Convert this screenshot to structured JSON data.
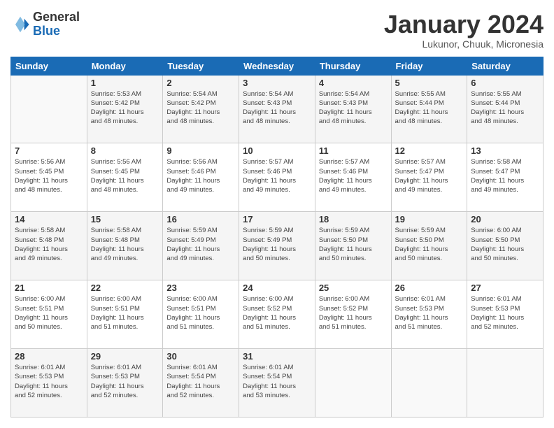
{
  "header": {
    "logo_line1": "General",
    "logo_line2": "Blue",
    "month_title": "January 2024",
    "location": "Lukunor, Chuuk, Micronesia"
  },
  "days_of_week": [
    "Sunday",
    "Monday",
    "Tuesday",
    "Wednesday",
    "Thursday",
    "Friday",
    "Saturday"
  ],
  "weeks": [
    [
      {
        "day": "",
        "info": ""
      },
      {
        "day": "1",
        "info": "Sunrise: 5:53 AM\nSunset: 5:42 PM\nDaylight: 11 hours\nand 48 minutes."
      },
      {
        "day": "2",
        "info": "Sunrise: 5:54 AM\nSunset: 5:42 PM\nDaylight: 11 hours\nand 48 minutes."
      },
      {
        "day": "3",
        "info": "Sunrise: 5:54 AM\nSunset: 5:43 PM\nDaylight: 11 hours\nand 48 minutes."
      },
      {
        "day": "4",
        "info": "Sunrise: 5:54 AM\nSunset: 5:43 PM\nDaylight: 11 hours\nand 48 minutes."
      },
      {
        "day": "5",
        "info": "Sunrise: 5:55 AM\nSunset: 5:44 PM\nDaylight: 11 hours\nand 48 minutes."
      },
      {
        "day": "6",
        "info": "Sunrise: 5:55 AM\nSunset: 5:44 PM\nDaylight: 11 hours\nand 48 minutes."
      }
    ],
    [
      {
        "day": "7",
        "info": "Sunrise: 5:56 AM\nSunset: 5:45 PM\nDaylight: 11 hours\nand 48 minutes."
      },
      {
        "day": "8",
        "info": "Sunrise: 5:56 AM\nSunset: 5:45 PM\nDaylight: 11 hours\nand 48 minutes."
      },
      {
        "day": "9",
        "info": "Sunrise: 5:56 AM\nSunset: 5:46 PM\nDaylight: 11 hours\nand 49 minutes."
      },
      {
        "day": "10",
        "info": "Sunrise: 5:57 AM\nSunset: 5:46 PM\nDaylight: 11 hours\nand 49 minutes."
      },
      {
        "day": "11",
        "info": "Sunrise: 5:57 AM\nSunset: 5:46 PM\nDaylight: 11 hours\nand 49 minutes."
      },
      {
        "day": "12",
        "info": "Sunrise: 5:57 AM\nSunset: 5:47 PM\nDaylight: 11 hours\nand 49 minutes."
      },
      {
        "day": "13",
        "info": "Sunrise: 5:58 AM\nSunset: 5:47 PM\nDaylight: 11 hours\nand 49 minutes."
      }
    ],
    [
      {
        "day": "14",
        "info": "Sunrise: 5:58 AM\nSunset: 5:48 PM\nDaylight: 11 hours\nand 49 minutes."
      },
      {
        "day": "15",
        "info": "Sunrise: 5:58 AM\nSunset: 5:48 PM\nDaylight: 11 hours\nand 49 minutes."
      },
      {
        "day": "16",
        "info": "Sunrise: 5:59 AM\nSunset: 5:49 PM\nDaylight: 11 hours\nand 49 minutes."
      },
      {
        "day": "17",
        "info": "Sunrise: 5:59 AM\nSunset: 5:49 PM\nDaylight: 11 hours\nand 50 minutes."
      },
      {
        "day": "18",
        "info": "Sunrise: 5:59 AM\nSunset: 5:50 PM\nDaylight: 11 hours\nand 50 minutes."
      },
      {
        "day": "19",
        "info": "Sunrise: 5:59 AM\nSunset: 5:50 PM\nDaylight: 11 hours\nand 50 minutes."
      },
      {
        "day": "20",
        "info": "Sunrise: 6:00 AM\nSunset: 5:50 PM\nDaylight: 11 hours\nand 50 minutes."
      }
    ],
    [
      {
        "day": "21",
        "info": "Sunrise: 6:00 AM\nSunset: 5:51 PM\nDaylight: 11 hours\nand 50 minutes."
      },
      {
        "day": "22",
        "info": "Sunrise: 6:00 AM\nSunset: 5:51 PM\nDaylight: 11 hours\nand 51 minutes."
      },
      {
        "day": "23",
        "info": "Sunrise: 6:00 AM\nSunset: 5:51 PM\nDaylight: 11 hours\nand 51 minutes."
      },
      {
        "day": "24",
        "info": "Sunrise: 6:00 AM\nSunset: 5:52 PM\nDaylight: 11 hours\nand 51 minutes."
      },
      {
        "day": "25",
        "info": "Sunrise: 6:00 AM\nSunset: 5:52 PM\nDaylight: 11 hours\nand 51 minutes."
      },
      {
        "day": "26",
        "info": "Sunrise: 6:01 AM\nSunset: 5:53 PM\nDaylight: 11 hours\nand 51 minutes."
      },
      {
        "day": "27",
        "info": "Sunrise: 6:01 AM\nSunset: 5:53 PM\nDaylight: 11 hours\nand 52 minutes."
      }
    ],
    [
      {
        "day": "28",
        "info": "Sunrise: 6:01 AM\nSunset: 5:53 PM\nDaylight: 11 hours\nand 52 minutes."
      },
      {
        "day": "29",
        "info": "Sunrise: 6:01 AM\nSunset: 5:53 PM\nDaylight: 11 hours\nand 52 minutes."
      },
      {
        "day": "30",
        "info": "Sunrise: 6:01 AM\nSunset: 5:54 PM\nDaylight: 11 hours\nand 52 minutes."
      },
      {
        "day": "31",
        "info": "Sunrise: 6:01 AM\nSunset: 5:54 PM\nDaylight: 11 hours\nand 53 minutes."
      },
      {
        "day": "",
        "info": ""
      },
      {
        "day": "",
        "info": ""
      },
      {
        "day": "",
        "info": ""
      }
    ]
  ]
}
